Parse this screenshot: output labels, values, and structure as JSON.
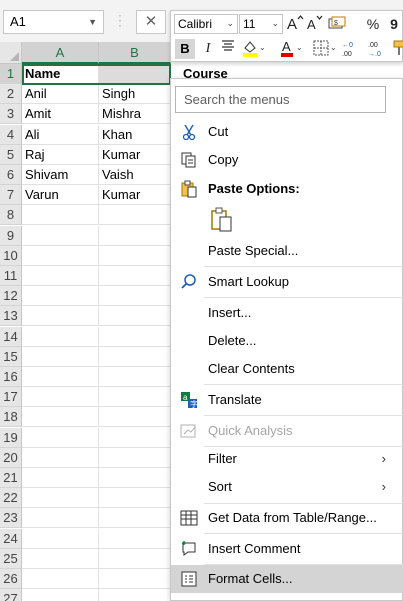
{
  "formula_bar": {
    "name_box": "A1",
    "cancel_glyph": "✕"
  },
  "columns": [
    "A",
    "B"
  ],
  "rows": [
    "1",
    "2",
    "3",
    "4",
    "5",
    "6",
    "7",
    "8",
    "9",
    "10",
    "11",
    "12",
    "13",
    "14",
    "15",
    "16",
    "17",
    "18",
    "19",
    "20",
    "21",
    "22",
    "23",
    "24",
    "25",
    "26",
    "27"
  ],
  "cells": {
    "A": [
      "Name",
      "Anil",
      "Amit",
      "Ali",
      "Raj",
      "Shivam",
      "Varun"
    ],
    "B": [
      "",
      "Singh",
      "Mishra",
      "Khan",
      "Kumar",
      "Vaish",
      "Kumar"
    ],
    "C1": "Course"
  },
  "mini_toolbar": {
    "font": "Calibri",
    "size": "11",
    "bold": "B",
    "italic": "I",
    "percent": "%",
    "comma": "9"
  },
  "menu": {
    "search_placeholder": "Search the menus",
    "cut": "Cut",
    "copy": "Copy",
    "paste_options": "Paste Options:",
    "paste_special": "Paste Special...",
    "smart_lookup": "Smart Lookup",
    "insert": "Insert...",
    "delete": "Delete...",
    "clear_contents": "Clear Contents",
    "translate": "Translate",
    "quick_analysis": "Quick Analysis",
    "filter": "Filter",
    "sort": "Sort",
    "get_data": "Get Data from Table/Range...",
    "insert_comment": "Insert Comment",
    "format_cells": "Format Cells...",
    "submenu_arrow": "›"
  },
  "colors": {
    "accent": "#217346",
    "hover": "#d4d4d4",
    "disabled": "#a6a6a6"
  }
}
